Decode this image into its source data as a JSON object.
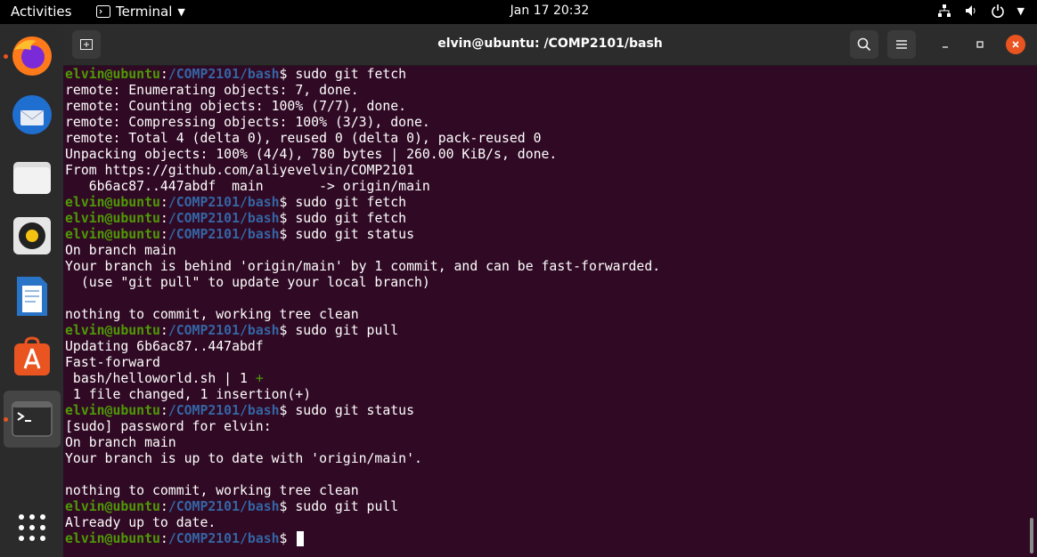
{
  "topbar": {
    "activities": "Activities",
    "app_menu": "Terminal",
    "clock": "Jan 17  20:32"
  },
  "dock": {
    "items": [
      {
        "name": "firefox",
        "icon": "firefox-icon",
        "running": true
      },
      {
        "name": "thunderbird",
        "icon": "thunderbird-icon",
        "running": false
      },
      {
        "name": "files",
        "icon": "files-icon",
        "running": false
      },
      {
        "name": "rhythmbox",
        "icon": "rhythmbox-icon",
        "running": false
      },
      {
        "name": "writer",
        "icon": "writer-icon",
        "running": false
      },
      {
        "name": "software",
        "icon": "software-icon",
        "running": false
      },
      {
        "name": "terminal",
        "icon": "terminal-icon",
        "running": true,
        "active": true
      }
    ]
  },
  "window": {
    "title": "elvin@ubuntu: /COMP2101/bash"
  },
  "terminal": {
    "prompt_user": "elvin@ubuntu",
    "prompt_path": "/COMP2101/bash",
    "lines": [
      {
        "type": "prompt",
        "cmd": "sudo git fetch"
      },
      {
        "type": "out",
        "text": "remote: Enumerating objects: 7, done."
      },
      {
        "type": "out",
        "text": "remote: Counting objects: 100% (7/7), done."
      },
      {
        "type": "out",
        "text": "remote: Compressing objects: 100% (3/3), done."
      },
      {
        "type": "out",
        "text": "remote: Total 4 (delta 0), reused 0 (delta 0), pack-reused 0"
      },
      {
        "type": "out",
        "text": "Unpacking objects: 100% (4/4), 780 bytes | 260.00 KiB/s, done."
      },
      {
        "type": "out",
        "text": "From https://github.com/aliyevelvin/COMP2101"
      },
      {
        "type": "out",
        "text": "   6b6ac87..447abdf  main       -> origin/main"
      },
      {
        "type": "prompt",
        "cmd": "sudo git fetch"
      },
      {
        "type": "prompt",
        "cmd": "sudo git fetch"
      },
      {
        "type": "prompt",
        "cmd": "sudo git status"
      },
      {
        "type": "out",
        "text": "On branch main"
      },
      {
        "type": "out",
        "text": "Your branch is behind 'origin/main' by 1 commit, and can be fast-forwarded."
      },
      {
        "type": "out",
        "text": "  (use \"git pull\" to update your local branch)"
      },
      {
        "type": "out",
        "text": ""
      },
      {
        "type": "out",
        "text": "nothing to commit, working tree clean"
      },
      {
        "type": "prompt",
        "cmd": "sudo git pull"
      },
      {
        "type": "out",
        "text": "Updating 6b6ac87..447abdf"
      },
      {
        "type": "out",
        "text": "Fast-forward"
      },
      {
        "type": "diff",
        "text": " bash/helloworld.sh | 1 ",
        "plus": "+"
      },
      {
        "type": "out",
        "text": " 1 file changed, 1 insertion(+)"
      },
      {
        "type": "prompt",
        "cmd": "sudo git status"
      },
      {
        "type": "out",
        "text": "[sudo] password for elvin:"
      },
      {
        "type": "out",
        "text": "On branch main"
      },
      {
        "type": "out",
        "text": "Your branch is up to date with 'origin/main'."
      },
      {
        "type": "out",
        "text": ""
      },
      {
        "type": "out",
        "text": "nothing to commit, working tree clean"
      },
      {
        "type": "prompt",
        "cmd": "sudo git pull"
      },
      {
        "type": "out",
        "text": "Already up to date."
      },
      {
        "type": "prompt",
        "cmd": "",
        "cursor": true
      }
    ]
  },
  "colors": {
    "terminal_bg": "#300a24",
    "prompt_user": "#4e9a06",
    "prompt_path": "#3465a4",
    "accent": "#e95420"
  }
}
